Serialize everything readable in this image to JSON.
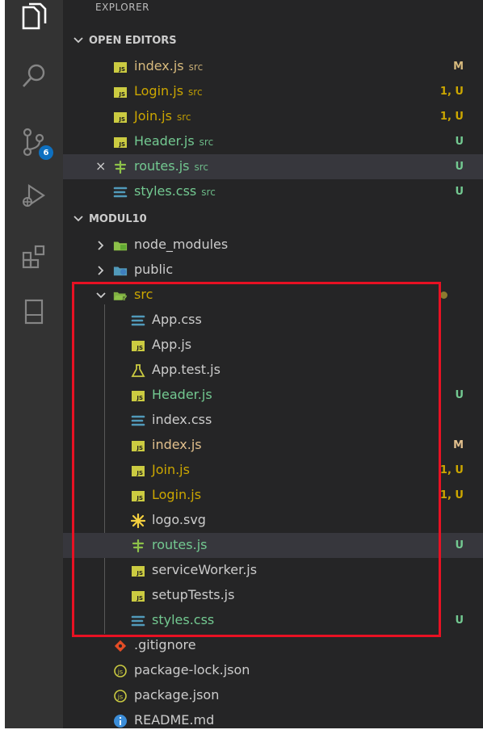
{
  "sidebar": {
    "title": "EXPLORER",
    "activity": {
      "scm_badge": "6"
    },
    "open_editors": {
      "label": "OPEN EDITORS",
      "items": [
        {
          "name": "index.js",
          "desc": "src",
          "status": "M",
          "color": "#d7ba7d",
          "icon": "js"
        },
        {
          "name": "Login.js",
          "desc": "src",
          "status": "1, U",
          "color": "#cca700",
          "icon": "js"
        },
        {
          "name": "Join.js",
          "desc": "src",
          "status": "1, U",
          "color": "#cca700",
          "icon": "js"
        },
        {
          "name": "Header.js",
          "desc": "src",
          "status": "U",
          "color": "#73c991",
          "icon": "js"
        },
        {
          "name": "routes.js",
          "desc": "src",
          "status": "U",
          "color": "#73c991",
          "icon": "routes"
        },
        {
          "name": "styles.css",
          "desc": "src",
          "status": "U",
          "color": "#73c991",
          "icon": "css"
        }
      ]
    },
    "project": {
      "label": "MODUL10",
      "folders": [
        {
          "name": "node_modules",
          "color": "#cccccc"
        },
        {
          "name": "public",
          "color": "#cccccc"
        }
      ],
      "src": {
        "name": "src",
        "color": "#cca700",
        "files": [
          {
            "name": "App.css",
            "status": "",
            "color": "#cccccc",
            "icon": "css"
          },
          {
            "name": "App.js",
            "status": "",
            "color": "#cccccc",
            "icon": "js"
          },
          {
            "name": "App.test.js",
            "status": "",
            "color": "#cccccc",
            "icon": "test"
          },
          {
            "name": "Header.js",
            "status": "U",
            "color": "#73c991",
            "icon": "js"
          },
          {
            "name": "index.css",
            "status": "",
            "color": "#cccccc",
            "icon": "css"
          },
          {
            "name": "index.js",
            "status": "M",
            "color": "#e2c08d",
            "icon": "js"
          },
          {
            "name": "Join.js",
            "status": "1, U",
            "color": "#cca700",
            "icon": "js"
          },
          {
            "name": "Login.js",
            "status": "1, U",
            "color": "#cca700",
            "icon": "js"
          },
          {
            "name": "logo.svg",
            "status": "",
            "color": "#cccccc",
            "icon": "svg"
          },
          {
            "name": "routes.js",
            "status": "U",
            "color": "#73c991",
            "icon": "routes"
          },
          {
            "name": "serviceWorker.js",
            "status": "",
            "color": "#cccccc",
            "icon": "js"
          },
          {
            "name": "setupTests.js",
            "status": "",
            "color": "#cccccc",
            "icon": "js"
          },
          {
            "name": "styles.css",
            "status": "U",
            "color": "#73c991",
            "icon": "css"
          }
        ]
      },
      "root_files": [
        {
          "name": ".gitignore",
          "color": "#cccccc",
          "icon": "git"
        },
        {
          "name": "package-lock.json",
          "color": "#cccccc",
          "icon": "npm"
        },
        {
          "name": "package.json",
          "color": "#cccccc",
          "icon": "npm"
        },
        {
          "name": "README.md",
          "color": "#cccccc",
          "icon": "info"
        }
      ]
    }
  }
}
